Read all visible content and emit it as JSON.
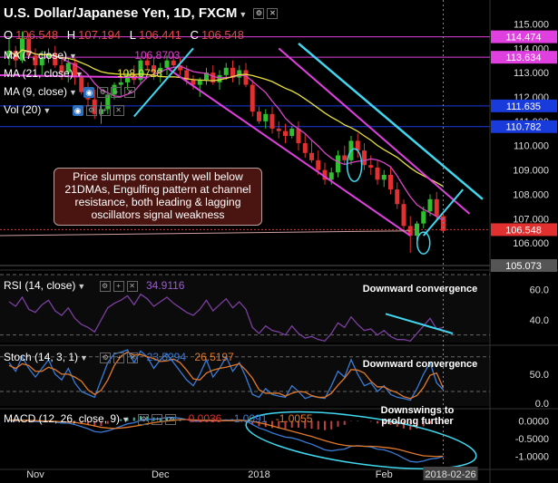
{
  "header": {
    "title": "U.S. Dollar/Japanese Yen, 1D, FXCM",
    "ohlc": {
      "o_label": "O",
      "o": "106.548",
      "h_label": "H",
      "h": "107.194",
      "l_label": "L",
      "l": "106.441",
      "c_label": "C",
      "c": "106.548"
    }
  },
  "indicators": {
    "ma7": {
      "label": "MA (7, close)",
      "value": "106.8703"
    },
    "ma21": {
      "label": "MA (21, close)",
      "value": "108.0728"
    },
    "ma9": {
      "label": "MA (9, close)"
    },
    "vol": {
      "label": "Vol (20)"
    },
    "rsi": {
      "label": "RSI (14, close)",
      "value": "34.9116"
    },
    "stoch": {
      "label": "Stoch (14, 3, 1)",
      "k": "23.5294",
      "d": "26.5197"
    },
    "macd": {
      "label": "MACD (12, 26, close, 9)",
      "hist": "-0.0036",
      "macd": "-1.0091",
      "signal": "-1.0055"
    }
  },
  "annotations": {
    "main_box": "Price slumps constantly well below 21DMAs, Engulfing pattern at channel resistance, both leading & lagging oscillators signal weakness",
    "rsi_note": "Downward convergence",
    "stoch_note": "Downward convergence",
    "macd_note": "Downswings to prolong further"
  },
  "colors": {
    "background": "#000000",
    "bull": "#2fbf2f",
    "bear": "#e03030",
    "ma7": "#d844c8",
    "ma21": "#e8e040",
    "channel": "#e040e0",
    "trend": "#40d8f0",
    "rsi": "#7b3fa0",
    "stoch_k": "#3a7bd5",
    "stoch_d": "#e07a2a",
    "macd": "#3a7bd5",
    "signal": "#e07a2a"
  },
  "chart_data": [
    {
      "type": "candlestick",
      "title": "U.S. Dollar/Japanese Yen, 1D, FXCM",
      "x_labels": [
        "Nov",
        "Dec",
        "2018",
        "Feb",
        "2018-02-26"
      ],
      "y_ticks": [
        106.0,
        107.0,
        108.0,
        109.0,
        110.0,
        111.0,
        112.0,
        113.0,
        114.0,
        115.0
      ],
      "price_tags": [
        {
          "value": "114.474",
          "color": "#e040e0"
        },
        {
          "value": "113.634",
          "color": "#e040e0"
        },
        {
          "value": "111.635",
          "color": "#1a3bdc"
        },
        {
          "value": "110.782",
          "color": "#1a3bdc"
        },
        {
          "value": "106.548",
          "color": "#e03030"
        },
        {
          "value": "105.073",
          "color": "#555555"
        }
      ],
      "ylim": [
        105.0,
        115.8
      ],
      "candles": [
        [
          113.6,
          114.5,
          113.3,
          113.9
        ],
        [
          113.9,
          114.1,
          113.2,
          113.5
        ],
        [
          113.5,
          114.7,
          113.4,
          114.4
        ],
        [
          114.4,
          114.6,
          113.6,
          113.7
        ],
        [
          113.7,
          114.0,
          113.1,
          113.3
        ],
        [
          113.3,
          113.9,
          112.9,
          113.6
        ],
        [
          113.6,
          114.0,
          113.4,
          113.8
        ],
        [
          113.8,
          114.1,
          113.2,
          113.3
        ],
        [
          113.3,
          113.6,
          112.7,
          113.0
        ],
        [
          113.0,
          113.6,
          112.6,
          113.4
        ],
        [
          113.4,
          113.6,
          112.5,
          112.8
        ],
        [
          112.8,
          113.0,
          112.1,
          112.2
        ],
        [
          112.2,
          112.6,
          111.6,
          111.9
        ],
        [
          111.9,
          112.3,
          111.1,
          111.3
        ],
        [
          111.3,
          111.8,
          110.9,
          111.5
        ],
        [
          111.5,
          112.4,
          111.3,
          112.1
        ],
        [
          112.1,
          112.6,
          111.9,
          112.5
        ],
        [
          112.5,
          112.9,
          112.1,
          112.6
        ],
        [
          112.6,
          113.1,
          112.3,
          112.9
        ],
        [
          112.9,
          113.3,
          112.5,
          112.7
        ],
        [
          112.7,
          113.6,
          112.5,
          113.5
        ],
        [
          113.5,
          113.8,
          113.1,
          113.3
        ],
        [
          113.3,
          113.6,
          112.7,
          113.0
        ],
        [
          113.0,
          113.4,
          112.6,
          113.2
        ],
        [
          113.2,
          113.7,
          112.9,
          113.5
        ],
        [
          113.5,
          113.8,
          113.2,
          113.3
        ],
        [
          113.3,
          113.6,
          112.9,
          113.1
        ],
        [
          113.1,
          113.3,
          112.5,
          112.7
        ],
        [
          112.7,
          112.9,
          112.3,
          112.5
        ],
        [
          112.5,
          112.8,
          112.0,
          112.7
        ],
        [
          112.7,
          113.2,
          112.5,
          113.0
        ],
        [
          113.0,
          113.3,
          112.5,
          112.6
        ],
        [
          112.6,
          113.1,
          112.3,
          112.9
        ],
        [
          112.9,
          113.4,
          112.7,
          113.2
        ],
        [
          113.2,
          113.5,
          112.6,
          112.8
        ],
        [
          112.8,
          113.3,
          112.5,
          113.1
        ],
        [
          113.1,
          113.4,
          112.4,
          112.5
        ],
        [
          112.5,
          112.7,
          111.2,
          111.4
        ],
        [
          111.4,
          111.6,
          110.9,
          111.0
        ],
        [
          111.0,
          111.5,
          110.7,
          111.3
        ],
        [
          111.3,
          111.6,
          110.5,
          110.7
        ],
        [
          110.7,
          111.0,
          110.3,
          110.6
        ],
        [
          110.6,
          110.9,
          110.1,
          110.4
        ],
        [
          110.4,
          110.8,
          110.3,
          110.7
        ],
        [
          110.7,
          111.0,
          109.8,
          110.1
        ],
        [
          110.1,
          110.5,
          109.5,
          109.7
        ],
        [
          109.7,
          110.2,
          109.3,
          109.4
        ],
        [
          109.4,
          109.8,
          108.8,
          109.0
        ],
        [
          109.0,
          109.3,
          108.4,
          108.6
        ],
        [
          108.6,
          109.1,
          108.4,
          108.9
        ],
        [
          108.9,
          109.8,
          108.7,
          109.6
        ],
        [
          109.6,
          110.0,
          109.2,
          109.4
        ],
        [
          109.4,
          110.4,
          109.2,
          110.2
        ],
        [
          110.2,
          110.5,
          109.5,
          109.8
        ],
        [
          109.8,
          110.1,
          109.0,
          109.2
        ],
        [
          109.2,
          109.6,
          108.8,
          109.1
        ],
        [
          109.1,
          109.4,
          108.4,
          108.6
        ],
        [
          108.6,
          109.0,
          108.3,
          108.8
        ],
        [
          108.8,
          109.1,
          108.0,
          108.2
        ],
        [
          108.2,
          108.5,
          107.4,
          107.6
        ],
        [
          107.6,
          107.8,
          106.6,
          106.7
        ],
        [
          106.7,
          107.1,
          105.6,
          106.3
        ],
        [
          106.3,
          106.9,
          106.1,
          106.8
        ],
        [
          106.8,
          107.5,
          106.6,
          107.3
        ],
        [
          107.3,
          108.0,
          107.1,
          107.8
        ],
        [
          107.8,
          108.1,
          106.9,
          107.1
        ],
        [
          107.1,
          107.3,
          106.4,
          106.5
        ]
      ]
    },
    {
      "type": "line",
      "title": "RSI (14, close)",
      "ylim": [
        25,
        70
      ],
      "y_ticks": [
        40.0,
        60.0
      ],
      "series": [
        {
          "name": "RSI",
          "values": [
            52,
            49,
            55,
            47,
            45,
            50,
            53,
            46,
            43,
            48,
            41,
            37,
            35,
            32,
            40,
            48,
            51,
            53,
            56,
            50,
            57,
            54,
            49,
            52,
            55,
            51,
            48,
            45,
            43,
            47,
            53,
            46,
            50,
            54,
            48,
            52,
            47,
            35,
            31,
            36,
            33,
            32,
            30,
            36,
            31,
            28,
            29,
            27,
            26,
            31,
            38,
            35,
            42,
            37,
            33,
            34,
            30,
            33,
            29,
            27,
            27,
            26,
            31,
            36,
            41,
            34,
            35
          ]
        }
      ]
    },
    {
      "type": "line",
      "title": "Stoch (14, 3, 1)",
      "ylim": [
        -5,
        100
      ],
      "y_ticks": [
        0.0,
        50.0
      ],
      "series": [
        {
          "name": "%K",
          "values": [
            70,
            55,
            80,
            60,
            45,
            60,
            75,
            50,
            40,
            60,
            35,
            20,
            15,
            10,
            40,
            70,
            85,
            88,
            92,
            70,
            90,
            80,
            60,
            75,
            85,
            70,
            55,
            40,
            30,
            50,
            75,
            45,
            60,
            80,
            55,
            70,
            45,
            15,
            10,
            25,
            15,
            12,
            10,
            30,
            20,
            8,
            12,
            10,
            8,
            30,
            55,
            45,
            75,
            50,
            30,
            35,
            20,
            30,
            15,
            10,
            8,
            5,
            25,
            50,
            70,
            35,
            23
          ]
        },
        {
          "name": "%D",
          "values": [
            65,
            60,
            68,
            65,
            55,
            55,
            62,
            58,
            50,
            50,
            45,
            38,
            23,
            15,
            22,
            40,
            65,
            81,
            88,
            83,
            84,
            80,
            77,
            72,
            73,
            76,
            70,
            57,
            42,
            40,
            52,
            57,
            60,
            62,
            65,
            68,
            57,
            43,
            23,
            17,
            17,
            17,
            12,
            17,
            20,
            19,
            13,
            10,
            10,
            17,
            31,
            43,
            58,
            57,
            52,
            38,
            28,
            28,
            22,
            18,
            11,
            8,
            13,
            27,
            48,
            52,
            26
          ]
        }
      ]
    },
    {
      "type": "line",
      "title": "MACD (12, 26, close, 9)",
      "ylim": [
        -1.3,
        0.35
      ],
      "y_ticks": [
        0.0,
        -0.5,
        -1.0
      ],
      "series": [
        {
          "name": "MACD",
          "values": [
            0.02,
            0.0,
            0.03,
            0.01,
            -0.02,
            -0.02,
            0.0,
            -0.03,
            -0.06,
            -0.06,
            -0.1,
            -0.16,
            -0.22,
            -0.3,
            -0.32,
            -0.28,
            -0.22,
            -0.15,
            -0.08,
            -0.05,
            0.02,
            0.05,
            0.05,
            0.07,
            0.1,
            0.1,
            0.08,
            0.04,
            0.0,
            -0.01,
            0.01,
            0.0,
            0.01,
            0.03,
            0.02,
            0.03,
            0.01,
            -0.1,
            -0.2,
            -0.26,
            -0.34,
            -0.4,
            -0.46,
            -0.48,
            -0.53,
            -0.6,
            -0.66,
            -0.74,
            -0.82,
            -0.85,
            -0.82,
            -0.8,
            -0.72,
            -0.7,
            -0.72,
            -0.74,
            -0.8,
            -0.82,
            -0.88,
            -0.96,
            -1.06,
            -1.15,
            -1.17,
            -1.14,
            -1.08,
            -1.06,
            -1.01
          ]
        },
        {
          "name": "Signal",
          "values": [
            0.03,
            0.02,
            0.02,
            0.02,
            0.01,
            0.0,
            0.0,
            -0.01,
            -0.02,
            -0.03,
            -0.04,
            -0.07,
            -0.1,
            -0.14,
            -0.18,
            -0.2,
            -0.21,
            -0.2,
            -0.18,
            -0.15,
            -0.12,
            -0.08,
            -0.05,
            -0.02,
            0.0,
            0.02,
            0.04,
            0.04,
            0.03,
            0.02,
            0.02,
            0.02,
            0.01,
            0.01,
            0.01,
            0.02,
            0.01,
            -0.01,
            -0.05,
            -0.09,
            -0.14,
            -0.19,
            -0.24,
            -0.29,
            -0.34,
            -0.39,
            -0.44,
            -0.5,
            -0.56,
            -0.61,
            -0.66,
            -0.69,
            -0.71,
            -0.71,
            -0.72,
            -0.72,
            -0.73,
            -0.75,
            -0.77,
            -0.8,
            -0.85,
            -0.9,
            -0.95,
            -0.99,
            -1.0,
            -1.01,
            -1.0
          ]
        }
      ]
    }
  ]
}
